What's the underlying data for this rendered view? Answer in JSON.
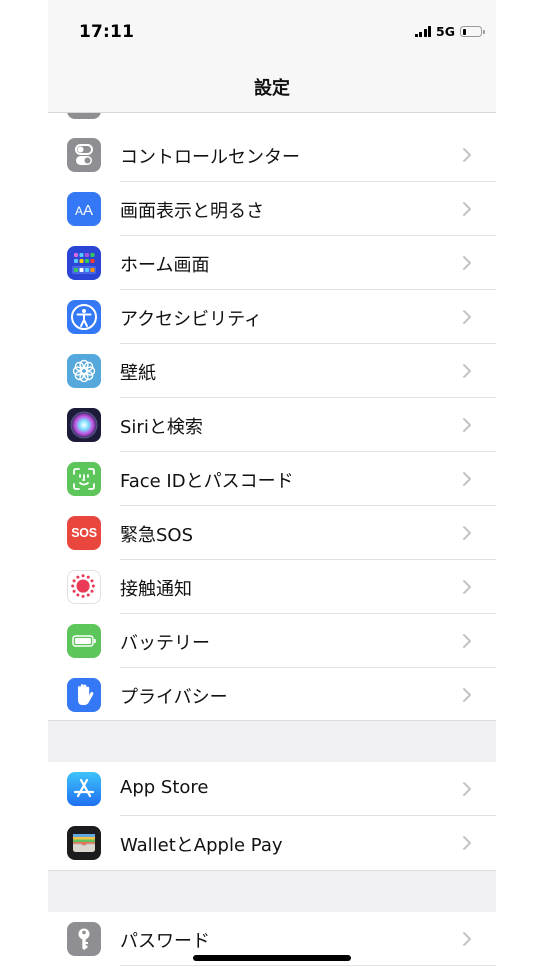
{
  "status_bar": {
    "time": "17:11",
    "network": "5G",
    "battery_percent": 20
  },
  "nav": {
    "title": "設定"
  },
  "groups": [
    {
      "items": [
        {
          "id": "control-center",
          "label": "コントロールセンター",
          "icon": "control-center-icon",
          "color": "#8e8e93"
        },
        {
          "id": "display",
          "label": "画面表示と明るさ",
          "icon": "display-brightness-icon",
          "color": "#3478f6"
        },
        {
          "id": "home-screen",
          "label": "ホーム画面",
          "icon": "home-screen-icon",
          "color": "#2b46d6"
        },
        {
          "id": "accessibility",
          "label": "アクセシビリティ",
          "icon": "accessibility-icon",
          "color": "#3478f6"
        },
        {
          "id": "wallpaper",
          "label": "壁紙",
          "icon": "wallpaper-icon",
          "color": "#55a8dc"
        },
        {
          "id": "siri",
          "label": "Siriと検索",
          "icon": "siri-icon",
          "color": "#1c1c3a"
        },
        {
          "id": "face-id",
          "label": "Face IDとパスコード",
          "icon": "face-id-icon",
          "color": "#5cc65a"
        },
        {
          "id": "sos",
          "label": "緊急SOS",
          "icon": "sos-icon",
          "color": "#e9473e",
          "icon_text": "SOS"
        },
        {
          "id": "exposure",
          "label": "接触通知",
          "icon": "exposure-notification-icon",
          "color": "#ffffff"
        },
        {
          "id": "battery",
          "label": "バッテリー",
          "icon": "battery-icon",
          "color": "#5cc65a"
        },
        {
          "id": "privacy",
          "label": "プライバシー",
          "icon": "privacy-hand-icon",
          "color": "#3478f6"
        }
      ]
    },
    {
      "items": [
        {
          "id": "app-store",
          "label": "App Store",
          "icon": "app-store-icon",
          "color": "#2d8cf0"
        },
        {
          "id": "wallet",
          "label": "WalletとApple Pay",
          "icon": "wallet-icon",
          "color": "#1c1c1e"
        }
      ]
    },
    {
      "items": [
        {
          "id": "passwords",
          "label": "パスワード",
          "icon": "key-icon",
          "color": "#8e8e93"
        }
      ]
    }
  ]
}
